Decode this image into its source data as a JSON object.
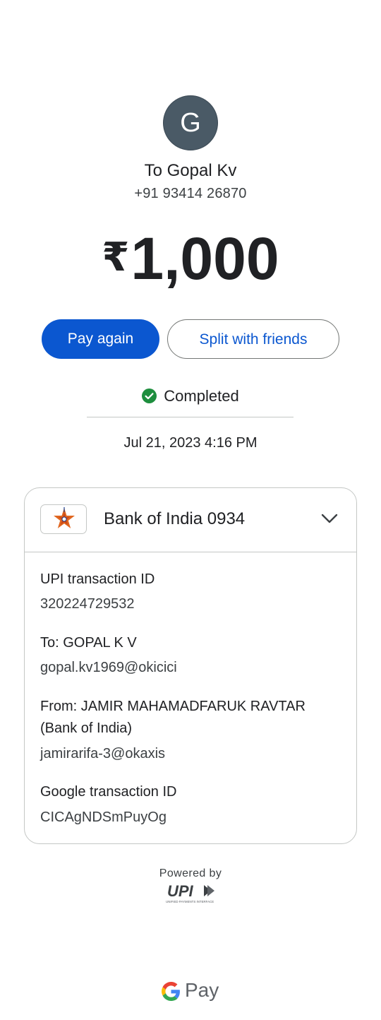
{
  "recipient": {
    "avatar_initial": "G",
    "name": "To Gopal Kv",
    "phone": "+91 93414 26870"
  },
  "amount": {
    "currency": "₹",
    "value": "1,000"
  },
  "actions": {
    "pay_again": "Pay again",
    "split": "Split with friends"
  },
  "status": {
    "text": "Completed",
    "color": "#1e8e3e",
    "datetime": "Jul 21, 2023 4:16 PM"
  },
  "bank": {
    "name": "Bank of India 0934",
    "logo_icon": "bank-of-india-star-icon",
    "expand_icon": "chevron-down-icon"
  },
  "details": {
    "upi_txn_label": "UPI transaction ID",
    "upi_txn_value": "320224729532",
    "to_label": "To: GOPAL K V",
    "to_value": "gopal.kv1969@okicici",
    "from_label": "From: JAMIR MAHAMADFARUK RAVTAR (Bank of India)",
    "from_value": "jamirarifa-3@okaxis",
    "google_txn_label": "Google transaction ID",
    "google_txn_value": "CICAgNDSmPuyOg"
  },
  "footer": {
    "powered_by": "Powered by",
    "upi_logo_text": "UPI",
    "upi_logo_subtext": "UNIFIED PAYMENTS INTERFACE",
    "gpay_label": "Pay"
  },
  "colors": {
    "primary": "#0b57d0",
    "avatar_bg": "#4a5a66"
  }
}
